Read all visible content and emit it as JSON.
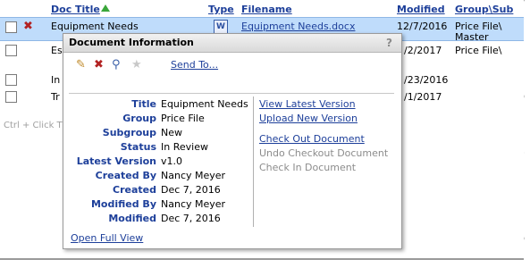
{
  "grid": {
    "columns": {
      "doc_title": "Doc Title",
      "type": "Type",
      "filename": "Filename",
      "modified": "Modified",
      "group": "Group\\Sub"
    },
    "rows": [
      {
        "title": "Equipment Needs",
        "filename": "Equipment Needs.docx",
        "modified": "12/7/2016",
        "group": "Price File\\",
        "group2": "Master"
      },
      {
        "title": "Es",
        "filename": "",
        "modified": "/2/2017",
        "group": "Price File\\",
        "group2": ""
      },
      {
        "title": "In",
        "filename": "",
        "modified": "/23/2016",
        "group": "",
        "group2": ""
      },
      {
        "title": "Tr",
        "filename": "",
        "modified": "/1/2017",
        "group": "",
        "group2": ""
      }
    ],
    "hint": "Ctrl + Click T"
  },
  "popup": {
    "title": "Document Information",
    "help": "?",
    "send_to": "Send To...",
    "fields": [
      {
        "label": "Title",
        "value": "Equipment Needs"
      },
      {
        "label": "Group",
        "value": "Price File"
      },
      {
        "label": "Subgroup",
        "value": "New"
      },
      {
        "label": "Status",
        "value": "In Review"
      },
      {
        "label": "Latest Version",
        "value": "v1.0"
      },
      {
        "label": "Created By",
        "value": "Nancy Meyer"
      },
      {
        "label": "Created",
        "value": "Dec 7, 2016"
      },
      {
        "label": "Modified By",
        "value": "Nancy Meyer"
      },
      {
        "label": "Modified",
        "value": "Dec 7, 2016"
      }
    ],
    "actions": {
      "view_latest": "View Latest Version",
      "upload_new": "Upload New Version",
      "check_out": "Check Out Document",
      "undo_checkout": "Undo Checkout Document",
      "check_in": "Check In Document"
    },
    "open_full": "Open Full View"
  },
  "icons": {
    "edit": "pencil-icon",
    "delete": "red-x-icon",
    "preview": "binoculars-icon",
    "favorite": "star-icon",
    "word": "word-document-icon"
  },
  "colors": {
    "link": "#1d3f9a",
    "selected_row": "#bfdcfb",
    "sort_arrow": "#3aa63a",
    "delete": "#b22222"
  }
}
